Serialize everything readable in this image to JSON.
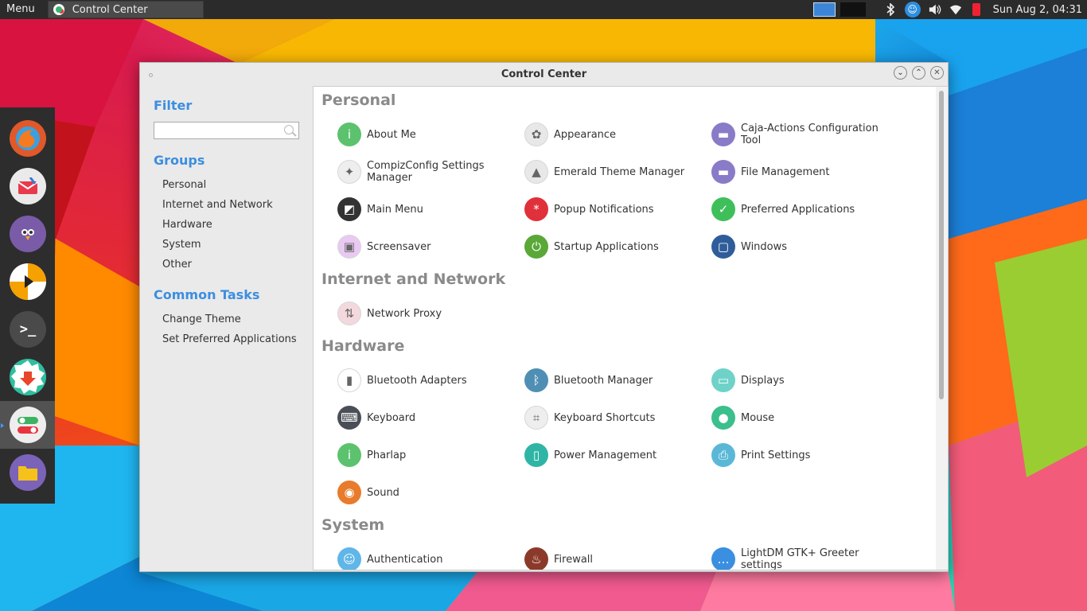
{
  "panel": {
    "menu_label": "Menu",
    "task_title": "Control Center",
    "clock": "Sun Aug  2, 04:31"
  },
  "window": {
    "title": "Control Center"
  },
  "sidebar": {
    "filter_heading": "Filter",
    "filter_value": "",
    "groups_heading": "Groups",
    "groups": [
      "Personal",
      "Internet and Network",
      "Hardware",
      "System",
      "Other"
    ],
    "tasks_heading": "Common Tasks",
    "tasks": [
      "Change Theme",
      "Set Preferred Applications"
    ]
  },
  "sections": [
    {
      "title": "Personal",
      "items": [
        {
          "label": "About Me",
          "icon": "info-icon",
          "color": "#5cc26e"
        },
        {
          "label": "Appearance",
          "icon": "palette-icon",
          "color": "#e8e8e8"
        },
        {
          "label": "Caja-Actions Configuration Tool",
          "icon": "folder-icon",
          "color": "#8a7bc9"
        },
        {
          "label": "CompizConfig Settings Manager",
          "icon": "wand-icon",
          "color": "#eeeeee"
        },
        {
          "label": "Emerald Theme Manager",
          "icon": "gem-icon",
          "color": "#e8e8e8"
        },
        {
          "label": "File Management",
          "icon": "folder-icon",
          "color": "#8a7bc9"
        },
        {
          "label": "Main Menu",
          "icon": "menu-icon",
          "color": "#333333"
        },
        {
          "label": "Popup Notifications",
          "icon": "notification-icon",
          "color": "#e0303a"
        },
        {
          "label": "Preferred Applications",
          "icon": "check-icon",
          "color": "#3fbf5a"
        },
        {
          "label": "Screensaver",
          "icon": "screensaver-icon",
          "color": "#e9c9f2"
        },
        {
          "label": "Startup Applications",
          "icon": "power-icon",
          "color": "#5aa838"
        },
        {
          "label": "Windows",
          "icon": "window-icon",
          "color": "#2f5d9a"
        }
      ]
    },
    {
      "title": "Internet and Network",
      "items": [
        {
          "label": "Network Proxy",
          "icon": "network-icon",
          "color": "#f3d9de"
        }
      ]
    },
    {
      "title": "Hardware",
      "items": [
        {
          "label": "Bluetooth Adapters",
          "icon": "usb-bluetooth-icon",
          "color": "#ffffff"
        },
        {
          "label": "Bluetooth Manager",
          "icon": "bluetooth-icon",
          "color": "#4f8fb3"
        },
        {
          "label": "Displays",
          "icon": "display-icon",
          "color": "#6fd2c9"
        },
        {
          "label": "Keyboard",
          "icon": "keyboard-icon",
          "color": "#4a4f57"
        },
        {
          "label": "Keyboard Shortcuts",
          "icon": "shortcut-icon",
          "color": "#eeeeee"
        },
        {
          "label": "Mouse",
          "icon": "mouse-icon",
          "color": "#3bbf8c"
        },
        {
          "label": "Pharlap",
          "icon": "info-icon",
          "color": "#5cc26e"
        },
        {
          "label": "Power Management",
          "icon": "battery-icon",
          "color": "#2fb5a5"
        },
        {
          "label": "Print Settings",
          "icon": "printer-icon",
          "color": "#5ab8d6"
        },
        {
          "label": "Sound",
          "icon": "speaker-icon",
          "color": "#e87b2c"
        }
      ]
    },
    {
      "title": "System",
      "items": [
        {
          "label": "Authentication",
          "icon": "user-icon",
          "color": "#5fb6e8"
        },
        {
          "label": "Firewall",
          "icon": "fire-icon",
          "color": "#8b3a2a"
        },
        {
          "label": "LightDM GTK+ Greeter settings",
          "icon": "greeter-icon",
          "color": "#3a8fe0"
        }
      ]
    }
  ]
}
